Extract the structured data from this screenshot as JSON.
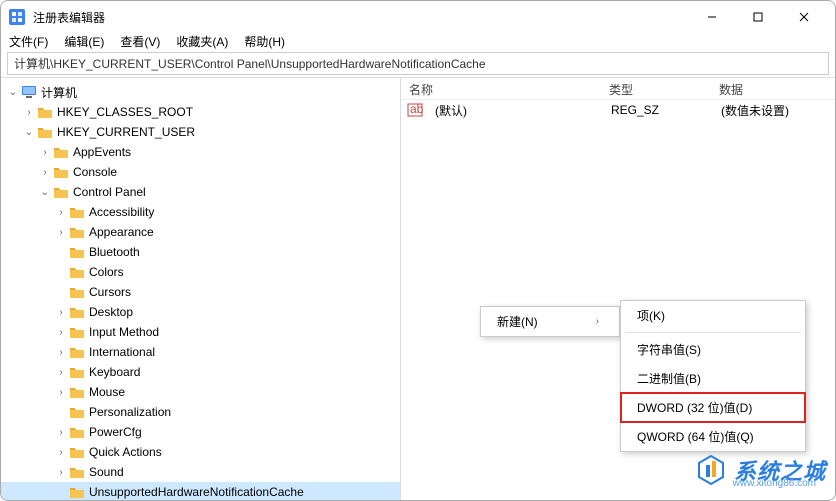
{
  "window": {
    "title": "注册表编辑器"
  },
  "menubar": {
    "file": "文件(F)",
    "edit": "编辑(E)",
    "view": "查看(V)",
    "favorites": "收藏夹(A)",
    "help": "帮助(H)"
  },
  "path": "计算机\\HKEY_CURRENT_USER\\Control Panel\\UnsupportedHardwareNotificationCache",
  "tree": {
    "root": "计算机",
    "hkcr": "HKEY_CLASSES_ROOT",
    "hkcu": "HKEY_CURRENT_USER",
    "items": [
      "AppEvents",
      "Console",
      "Control Panel"
    ],
    "cp_children": [
      "Accessibility",
      "Appearance",
      "Bluetooth",
      "Colors",
      "Cursors",
      "Desktop",
      "Input Method",
      "International",
      "Keyboard",
      "Mouse",
      "Personalization",
      "PowerCfg",
      "Quick Actions",
      "Sound",
      "UnsupportedHardwareNotificationCache"
    ]
  },
  "listview": {
    "headers": {
      "name": "名称",
      "type": "类型",
      "data": "数据"
    },
    "row": {
      "name": "(默认)",
      "type": "REG_SZ",
      "data": "(数值未设置)"
    }
  },
  "context": {
    "new": "新建(N)",
    "sub": {
      "key": "项(K)",
      "string": "字符串值(S)",
      "binary": "二进制值(B)",
      "dword": "DWORD (32 位)值(D)",
      "qword": "QWORD (64 位)值(Q)"
    }
  },
  "watermark": {
    "text": "系统之城",
    "sub": "www.xitong86.com"
  }
}
